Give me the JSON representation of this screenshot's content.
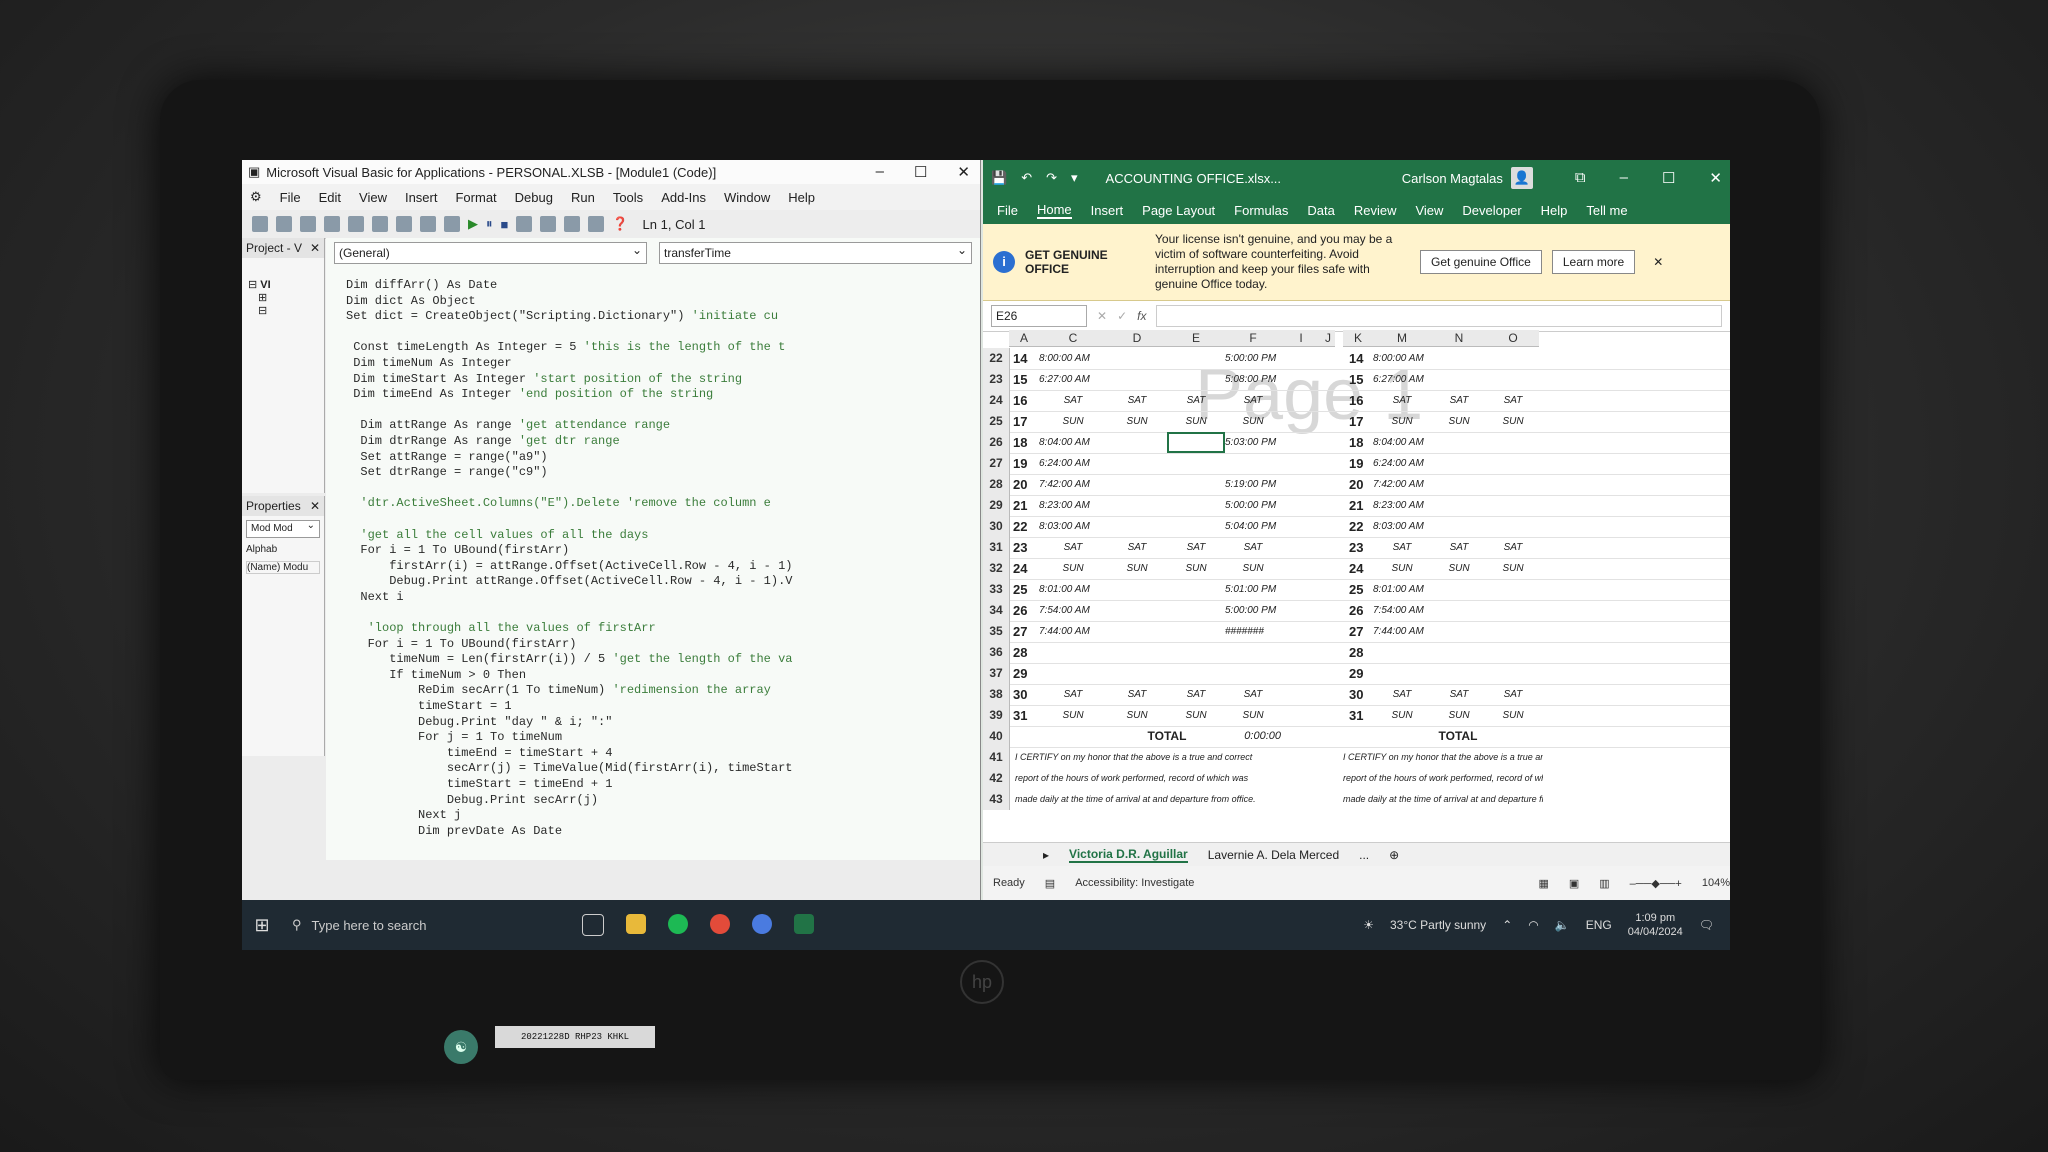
{
  "vba": {
    "title": "Microsoft Visual Basic for Applications - PERSONAL.XLSB - [Module1 (Code)]",
    "menu": [
      "File",
      "Edit",
      "View",
      "Insert",
      "Format",
      "Debug",
      "Run",
      "Tools",
      "Add-Ins",
      "Window",
      "Help"
    ],
    "position": "Ln 1, Col 1",
    "project_pane_title": "Project - V",
    "properties_title": "Properties",
    "prop_combo": "Mod Mod",
    "prop_tab": "Alphab",
    "prop_name": "(Name) Modu",
    "tree_label": "VI",
    "object_combo": "(General)",
    "proc_combo": "transferTime",
    "code_lines": [
      "Dim diffArr() As Date",
      "Dim dict As Object",
      "Set dict = CreateObject(\"Scripting.Dictionary\") 'initiate cu",
      "",
      " Const timeLength As Integer = 5 'this is the length of the t",
      " Dim timeNum As Integer",
      " Dim timeStart As Integer 'start position of the string",
      " Dim timeEnd As Integer 'end position of the string",
      "",
      "  Dim attRange As range 'get attendance range",
      "  Dim dtrRange As range 'get dtr range",
      "  Set attRange = range(\"a9\")",
      "  Set dtrRange = range(\"c9\")",
      "",
      "  'dtr.ActiveSheet.Columns(\"E\").Delete 'remove the column e",
      "",
      "  'get all the cell values of all the days",
      "  For i = 1 To UBound(firstArr)",
      "      firstArr(i) = attRange.Offset(ActiveCell.Row - 4, i - 1)",
      "      Debug.Print attRange.Offset(ActiveCell.Row - 4, i - 1).V",
      "  Next i",
      "",
      "   'loop through all the values of firstArr",
      "   For i = 1 To UBound(firstArr)",
      "      timeNum = Len(firstArr(i)) / 5 'get the length of the va",
      "      If timeNum > 0 Then",
      "          ReDim secArr(1 To timeNum) 'redimension the array",
      "          timeStart = 1",
      "          Debug.Print \"day \" & i; \":\"",
      "          For j = 1 To timeNum",
      "              timeEnd = timeStart + 4",
      "              secArr(j) = TimeValue(Mid(firstArr(i), timeStart",
      "              timeStart = timeEnd + 1",
      "              Debug.Print secArr(j)",
      "          Next j",
      "          Dim prevDate As Date"
    ]
  },
  "excel": {
    "title": "ACCOUNTING OFFICE.xlsx...",
    "user": "Carlson Magtalas",
    "tabs": [
      "File",
      "Home",
      "Insert",
      "Page Layout",
      "Formulas",
      "Data",
      "Review",
      "View",
      "Developer",
      "Help",
      "Tell me"
    ],
    "banner": {
      "heading": "GET GENUINE OFFICE",
      "message": "Your license isn't genuine, and you may be a victim of software counterfeiting. Avoid interruption and keep your files safe with genuine Office today.",
      "btn_primary": "Get genuine Office",
      "btn_secondary": "Learn more"
    },
    "name_box": "E26",
    "fx_label": "fx",
    "left_cols": [
      "A",
      "C",
      "D",
      "E",
      "F",
      "I",
      "J"
    ],
    "right_cols": [
      "K",
      "M",
      "N",
      "O"
    ],
    "watermark": "Page 1",
    "rows": [
      {
        "rn": "22",
        "day": "14",
        "c": "8:00:00 AM",
        "d": "",
        "e": "",
        "f": "5:00:00 PM",
        "m": "8:00:00 AM",
        "n": "",
        "o": ""
      },
      {
        "rn": "23",
        "day": "15",
        "c": "6:27:00 AM",
        "d": "",
        "e": "",
        "f": "5:08:00 PM",
        "m": "6:27:00 AM",
        "n": "",
        "o": ""
      },
      {
        "rn": "24",
        "day": "16",
        "c": "SAT",
        "d": "SAT",
        "e": "SAT",
        "f": "SAT",
        "m": "SAT",
        "n": "SAT",
        "o": "SAT"
      },
      {
        "rn": "25",
        "day": "17",
        "c": "SUN",
        "d": "SUN",
        "e": "SUN",
        "f": "SUN",
        "m": "SUN",
        "n": "SUN",
        "o": "SUN"
      },
      {
        "rn": "26",
        "day": "18",
        "c": "8:04:00 AM",
        "d": "",
        "e": "",
        "f": "5:03:00 PM",
        "m": "8:04:00 AM",
        "n": "",
        "o": ""
      },
      {
        "rn": "27",
        "day": "19",
        "c": "6:24:00 AM",
        "d": "",
        "e": "",
        "f": "",
        "m": "6:24:00 AM",
        "n": "",
        "o": ""
      },
      {
        "rn": "28",
        "day": "20",
        "c": "7:42:00 AM",
        "d": "",
        "e": "",
        "f": "5:19:00 PM",
        "m": "7:42:00 AM",
        "n": "",
        "o": ""
      },
      {
        "rn": "29",
        "day": "21",
        "c": "8:23:00 AM",
        "d": "",
        "e": "",
        "f": "5:00:00 PM",
        "m": "8:23:00 AM",
        "n": "",
        "o": ""
      },
      {
        "rn": "30",
        "day": "22",
        "c": "8:03:00 AM",
        "d": "",
        "e": "",
        "f": "5:04:00 PM",
        "m": "8:03:00 AM",
        "n": "",
        "o": ""
      },
      {
        "rn": "31",
        "day": "23",
        "c": "SAT",
        "d": "SAT",
        "e": "SAT",
        "f": "SAT",
        "m": "SAT",
        "n": "SAT",
        "o": "SAT"
      },
      {
        "rn": "32",
        "day": "24",
        "c": "SUN",
        "d": "SUN",
        "e": "SUN",
        "f": "SUN",
        "m": "SUN",
        "n": "SUN",
        "o": "SUN"
      },
      {
        "rn": "33",
        "day": "25",
        "c": "8:01:00 AM",
        "d": "",
        "e": "",
        "f": "5:01:00 PM",
        "m": "8:01:00 AM",
        "n": "",
        "o": ""
      },
      {
        "rn": "34",
        "day": "26",
        "c": "7:54:00 AM",
        "d": "",
        "e": "",
        "f": "5:00:00 PM",
        "m": "7:54:00 AM",
        "n": "",
        "o": ""
      },
      {
        "rn": "35",
        "day": "27",
        "c": "7:44:00 AM",
        "d": "",
        "e": "",
        "f": "#######",
        "m": "7:44:00 AM",
        "n": "",
        "o": ""
      },
      {
        "rn": "36",
        "day": "28",
        "c": "",
        "d": "",
        "e": "",
        "f": "",
        "m": "",
        "n": "",
        "o": ""
      },
      {
        "rn": "37",
        "day": "29",
        "c": "",
        "d": "",
        "e": "",
        "f": "",
        "m": "",
        "n": "",
        "o": ""
      },
      {
        "rn": "38",
        "day": "30",
        "c": "SAT",
        "d": "SAT",
        "e": "SAT",
        "f": "SAT",
        "m": "SAT",
        "n": "SAT",
        "o": "SAT"
      },
      {
        "rn": "39",
        "day": "31",
        "c": "SUN",
        "d": "SUN",
        "e": "SUN",
        "f": "SUN",
        "m": "SUN",
        "n": "SUN",
        "o": "SUN"
      }
    ],
    "total_label": "TOTAL",
    "total_value": "0:00:00",
    "certify_lines": [
      "I CERTIFY on my honor that the above is a true and correct",
      "report of the hours of work performed, record of which was",
      "made daily at the time of arrival at and departure from office."
    ],
    "certify_right_lines": [
      "I CERTIFY on my honor that the above is a true and c",
      "report of the hours of work performed, record of which wa",
      "made daily at the time of arrival at and departure from off"
    ],
    "row_nums_extra": [
      "40",
      "41",
      "42",
      "43"
    ],
    "sheet_tabs": [
      "Victoria D.R. Aguillar",
      "Lavernie A. Dela Merced",
      "..."
    ],
    "status_ready": "Ready",
    "accessibility": "Accessibility: Investigate",
    "zoom": "104%"
  },
  "taskbar": {
    "search_placeholder": "Type here to search",
    "weather": "33°C  Partly sunny",
    "lang": "ENG",
    "time": "1:09 pm",
    "date": "04/04/2024"
  },
  "sticker_text": "20221228D RHP23 KHKL"
}
